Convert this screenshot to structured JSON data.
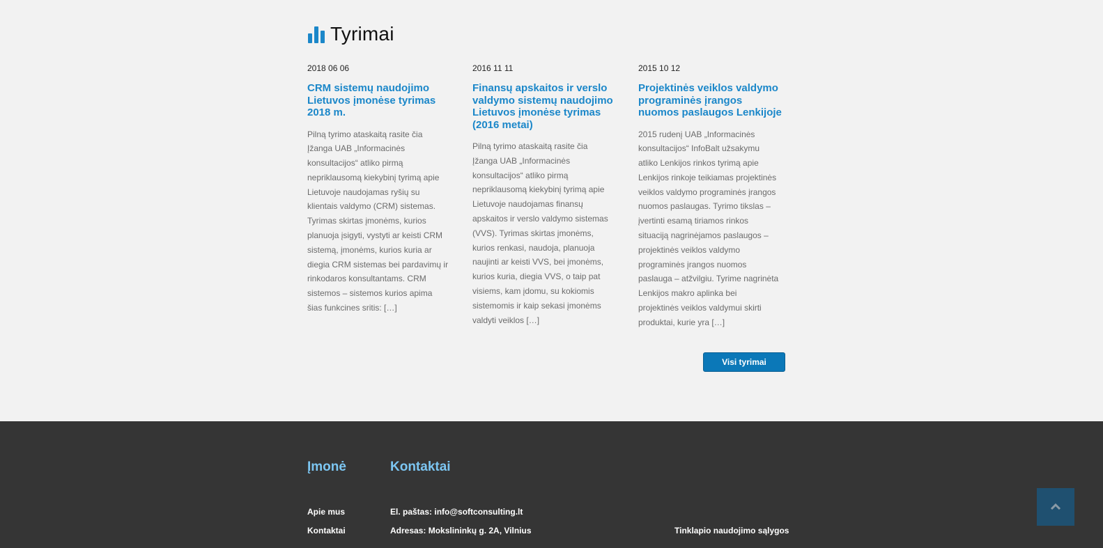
{
  "section": {
    "title": "Tyrimai",
    "icon": "bar-chart-icon",
    "accent": "#1b87c9"
  },
  "articles": [
    {
      "date": "2018 06 06",
      "title_lines": [
        "CRM sistemų naudojimo",
        "Lietuvos įmonėse tyrimas",
        "2018 m."
      ],
      "lines": [
        "Pilną tyrimo ataskaitą rasite čia",
        "Įžanga UAB „Informacinės",
        "konsultacijos“ atliko pirmą",
        "nepriklausomą kiekybinį tyrimą apie",
        "Lietuvoje naudojamas ryšių su",
        "klientais valdymo (CRM) sistemas.",
        "Tyrimas skirtas įmonėms, kurios",
        "planuoja įsigyti, vystyti ar keisti CRM",
        "sistemą, įmonėms, kurios kuria ar",
        "diegia CRM sistemas bei pardavimų ir",
        "rinkodaros konsultantams. CRM",
        "sistemos – sistemos kurios apima",
        "šias funkcines sritis: […]"
      ]
    },
    {
      "date": "2016 11 11",
      "title_lines": [
        "Finansų apskaitos ir verslo",
        "valdymo sistemų naudojimo",
        "Lietuvos įmonėse tyrimas",
        "(2016 metai)"
      ],
      "lines": [
        "Pilną tyrimo ataskaitą rasite čia",
        "Įžanga UAB „Informacinės",
        "konsultacijos“ atliko pirmą",
        "nepriklausomą kiekybinį tyrimą apie",
        "Lietuvoje naudojamas finansų",
        "apskaitos ir verslo valdymo sistemas",
        "(VVS). Tyrimas skirtas įmonėms,",
        "kurios renkasi, naudoja, planuoja",
        "naujinti ar keisti VVS, bei įmonėms,",
        "kurios kuria, diegia VVS, o taip pat",
        "visiems, kam įdomu, su kokiomis",
        "sistemomis ir kaip sekasi įmonėms",
        "valdyti veiklos […]"
      ]
    },
    {
      "date": "2015 10 12",
      "title_lines": [
        "Projektinės veiklos valdymo",
        "programinės įrangos",
        "nuomos paslaugos Lenkijoje"
      ],
      "lines": [
        "2015 rudenį UAB „Informacinės",
        "konsultacijos“ InfoBalt užsakymu",
        "atliko Lenkijos rinkos tyrimą apie",
        "Lenkijos rinkoje teikiamas projektinės",
        "veiklos valdymo programinės įrangos",
        "nuomos paslaugas. Tyrimo tikslas –",
        "įvertinti esamą tiriamos rinkos",
        "situaciją nagrinėjamos paslaugos –",
        "projektinės veiklos valdymo",
        "programinės įrangos nuomos",
        "paslauga – atžvilgiu. Tyrime nagrinėta",
        "Lenkijos makro aplinka  bei",
        "projektinės veiklos valdymui skirti",
        "produktai, kurie yra […]"
      ]
    }
  ],
  "all_button": "Visi tyrimai",
  "footer": {
    "company_heading": "Įmonė",
    "contacts_heading": "Kontaktai",
    "company_links": [
      "Apie mus",
      "Kontaktai"
    ],
    "email": "El. paštas: info@softconsulting.lt",
    "address": "Adresas: Mokslininkų g. 2A, Vilnius",
    "terms": "Tinklapio naudojimo sąlygos"
  },
  "scroll_top_icon": "chevron-up-icon"
}
